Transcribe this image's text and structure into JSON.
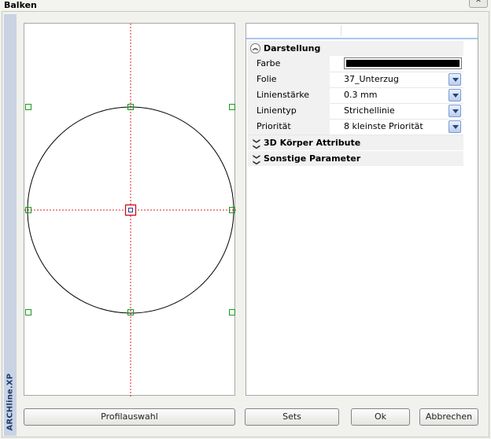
{
  "window": {
    "title": "Balken"
  },
  "branding": {
    "vertical_text": "ARCHline.XP"
  },
  "preview": {
    "colors": {
      "outline": "#000000",
      "axis": "#e02020",
      "handle": "#1a9a1a",
      "center_marker": "#cc0000",
      "center_inner": "#2a3a9a"
    }
  },
  "properties": {
    "sections": [
      {
        "title": "Darstellung",
        "expanded": true,
        "rows": [
          {
            "name": "Farbe",
            "type": "color",
            "value": "#000000"
          },
          {
            "name": "Folie",
            "type": "combo",
            "value": "37_Unterzug"
          },
          {
            "name": "Linienstärke",
            "type": "combo",
            "value": "0.3 mm"
          },
          {
            "name": "Linientyp",
            "type": "combo",
            "value": "Strichellinie"
          },
          {
            "name": "Priorität",
            "type": "combo",
            "value": "8 kleinste Priorität"
          }
        ]
      },
      {
        "title": "3D Körper Attribute",
        "expanded": false
      },
      {
        "title": "Sonstige Parameter",
        "expanded": false
      }
    ]
  },
  "buttons": {
    "profilauswahl": "Profilauswahl",
    "sets": "Sets",
    "ok": "Ok",
    "abbrechen": "Abbrechen"
  }
}
